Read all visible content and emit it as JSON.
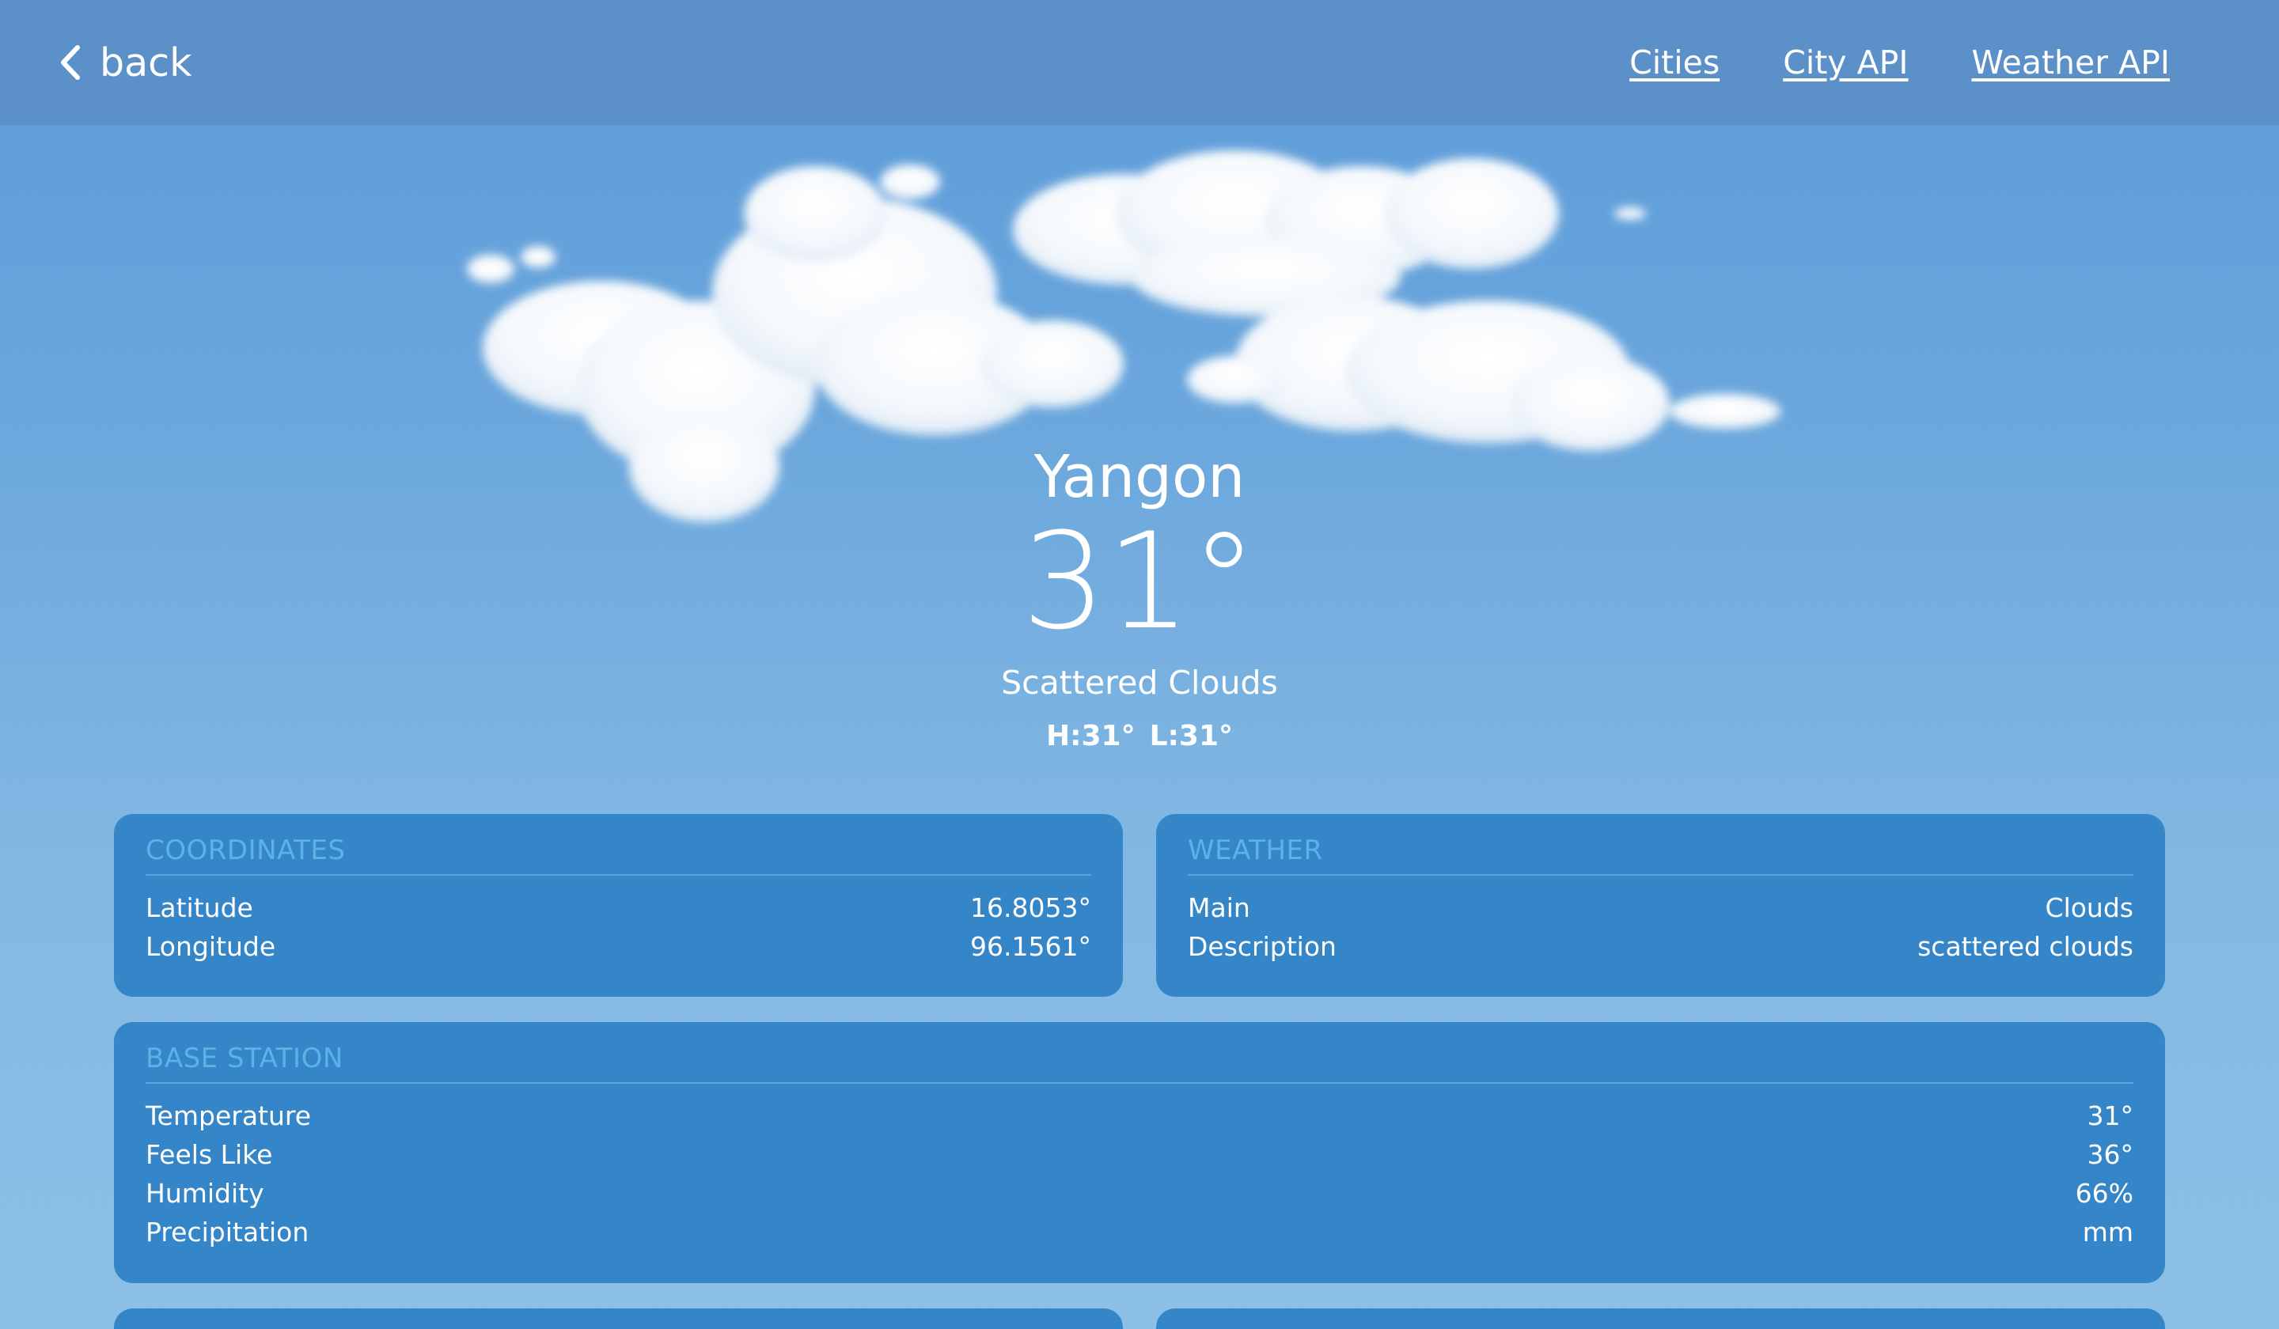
{
  "nav": {
    "back_label": "back",
    "links": [
      "Cities",
      "City API",
      "Weather API"
    ]
  },
  "hero": {
    "city": "Yangon",
    "temperature": "31°",
    "condition": "Scattered Clouds",
    "high": "H:31°",
    "low": "L:31°"
  },
  "coordinates": {
    "title": "COORDINATES",
    "rows": [
      {
        "label": "Latitude",
        "value": "16.8053°"
      },
      {
        "label": "Longitude",
        "value": "96.1561°"
      }
    ]
  },
  "weather": {
    "title": "WEATHER",
    "rows": [
      {
        "label": "Main",
        "value": "Clouds"
      },
      {
        "label": "Description",
        "value": "scattered clouds"
      }
    ]
  },
  "base_station": {
    "title": "BASE STATION",
    "rows": [
      {
        "label": "Temperature",
        "value": "31°"
      },
      {
        "label": "Feels Like",
        "value": "36°"
      },
      {
        "label": "Humidity",
        "value": "66%"
      },
      {
        "label": "Precipitation",
        "value": "mm"
      }
    ]
  },
  "colors": {
    "nav_bg": "#5b91c8",
    "card_bg": "#3586c8",
    "card_title": "#5cb2e6"
  },
  "icons": {
    "back": "chevron-left-icon",
    "weather_art": "scattered-clouds-icon"
  }
}
